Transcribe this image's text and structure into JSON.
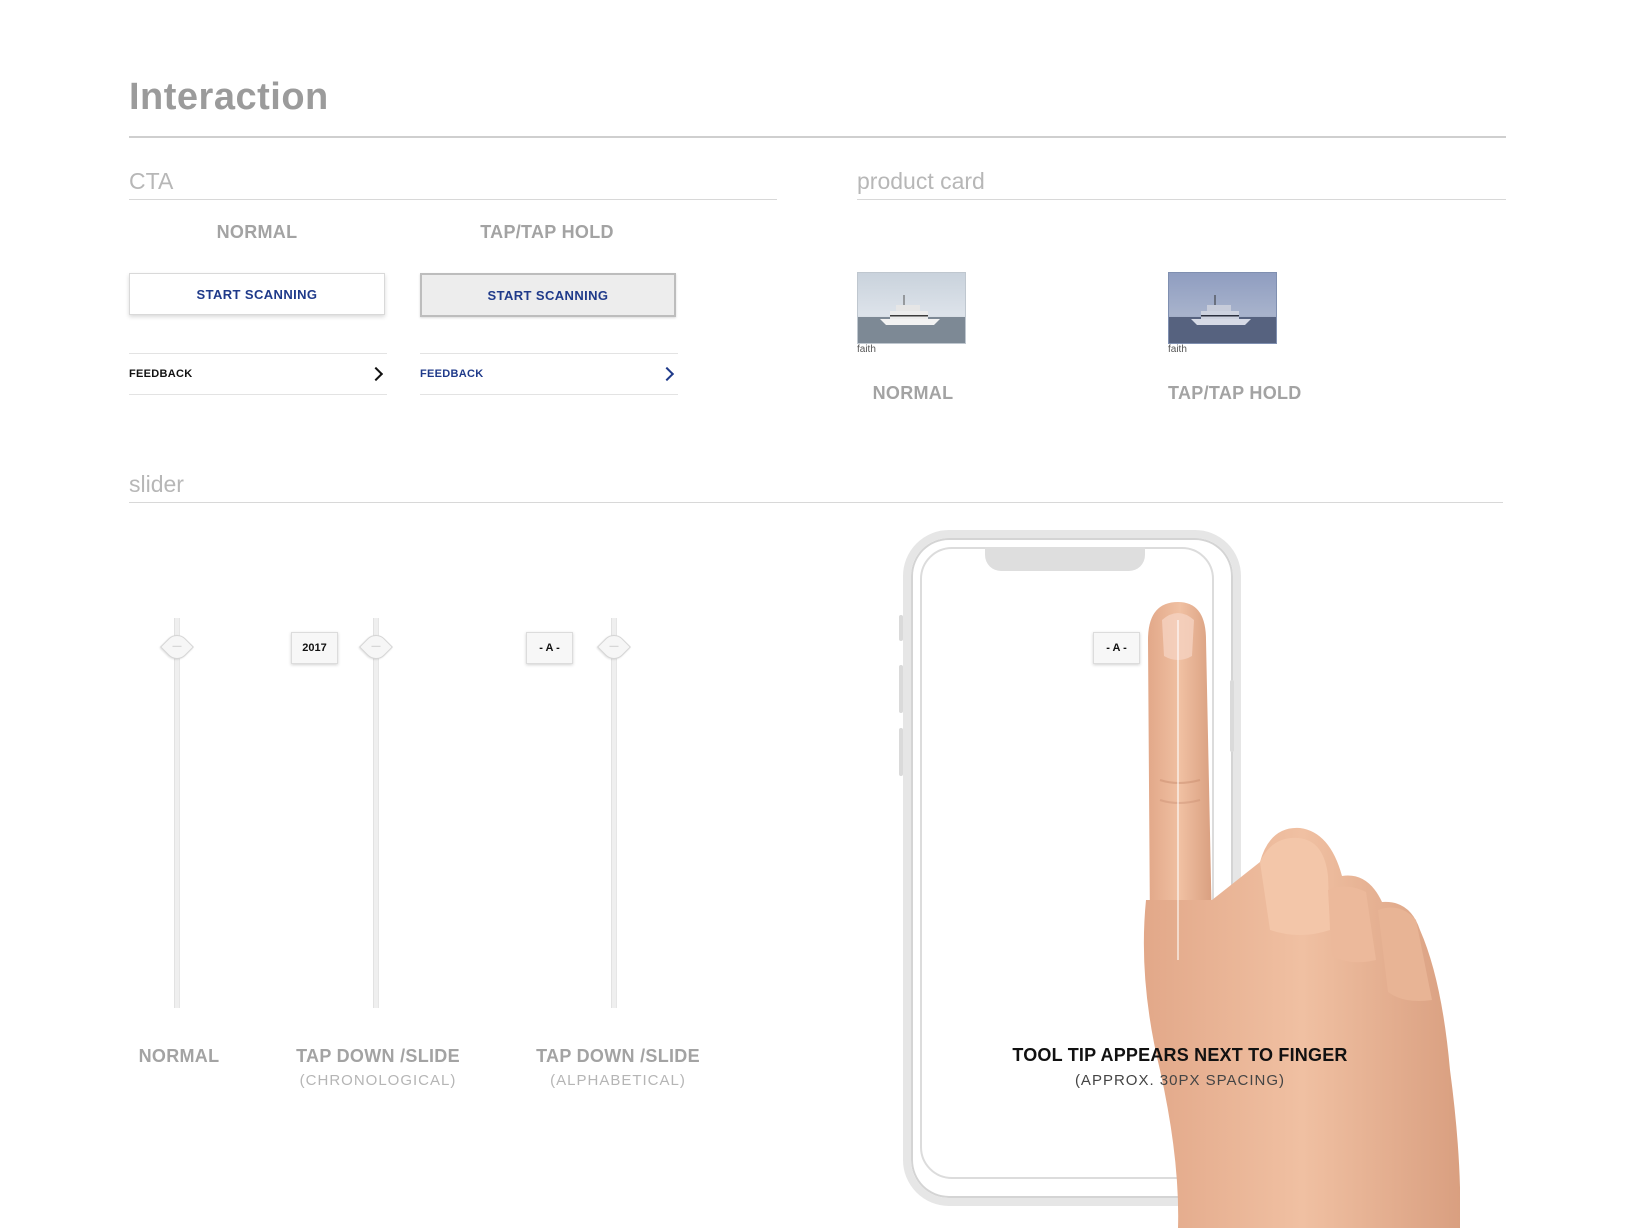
{
  "page": {
    "title": "Interaction"
  },
  "cta": {
    "section_title": "CTA",
    "normal_label": "NORMAL",
    "tap_label": "TAP/TAP HOLD",
    "button_label": "START SCANNING",
    "link_label": "FEEDBACK",
    "link_color": "#1f3a8a"
  },
  "product_card": {
    "section_title": "product card",
    "caption": "faith",
    "normal_label": "NORMAL",
    "tap_label": "TAP/TAP HOLD"
  },
  "slider": {
    "section_title": "slider",
    "normal_label": "NORMAL",
    "chrono_label": "TAP DOWN /SLIDE",
    "chrono_sub": "(CHRONOLOGICAL)",
    "alpha_label": "TAP DOWN /SLIDE",
    "alpha_sub": "(ALPHABETICAL)",
    "tip_year": "2017",
    "tip_letter": "- A -",
    "finger_tip_letter": "- A -",
    "finger_note_title": "TOOL TIP APPEARS NEXT TO FINGER",
    "finger_note_sub": "(APPROX. 30PX SPACING)"
  },
  "icons": [
    "chevron-right-icon",
    "slider-knob-icon",
    "hand-icon"
  ]
}
